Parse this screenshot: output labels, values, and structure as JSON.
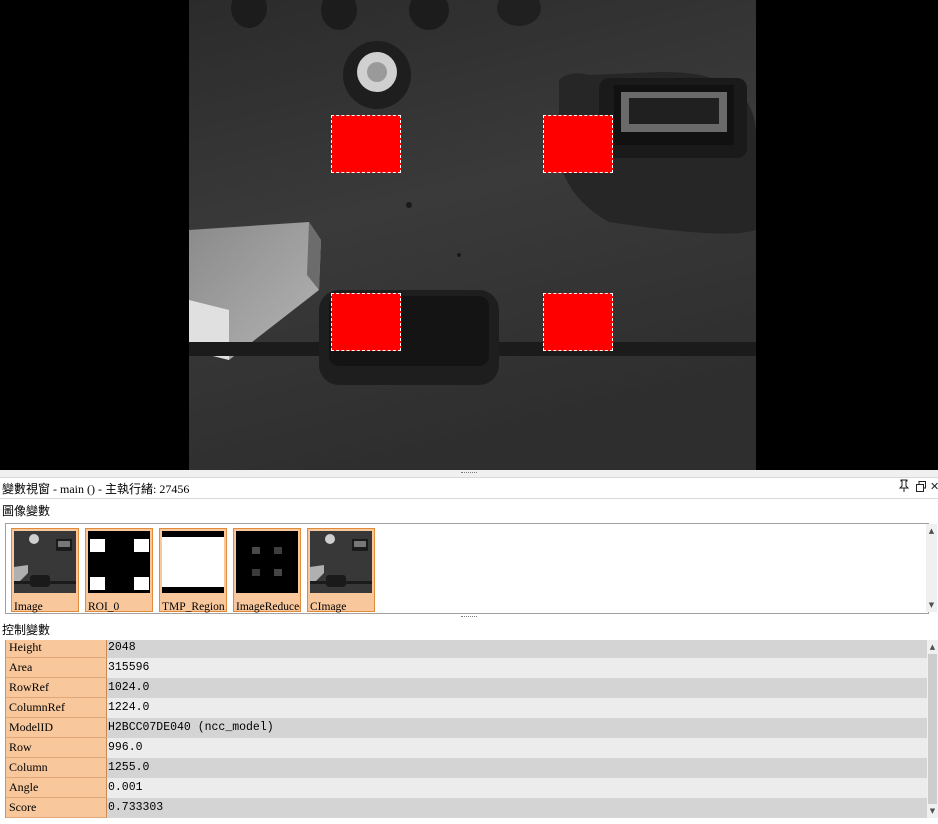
{
  "graphics": {
    "image_description_icon": "grayscale-camera-image-icon"
  },
  "variable_window": {
    "title": "變數視窗 - main () - 主執行緒: 27456",
    "pin_icon": "pin-icon",
    "restore_icon": "restore-window-icon",
    "close_icon": "close-icon"
  },
  "iconic_section": {
    "label": "圖像變數",
    "items": [
      {
        "label": "Image",
        "icon": "image-thumbnail-icon"
      },
      {
        "label": "ROI_0",
        "icon": "roi-thumbnail-icon"
      },
      {
        "label": "TMP_Region",
        "icon": "region-thumbnail-icon"
      },
      {
        "label": "ImageReduced",
        "icon": "reduced-image-thumbnail-icon"
      },
      {
        "label": "CImage",
        "icon": "cimage-thumbnail-icon"
      }
    ]
  },
  "control_section": {
    "label": "控制變數",
    "rows": [
      {
        "name": "Height",
        "value": "2048"
      },
      {
        "name": "Area",
        "value": "315596"
      },
      {
        "name": "RowRef",
        "value": "1024.0"
      },
      {
        "name": "ColumnRef",
        "value": "1224.0"
      },
      {
        "name": "ModelID",
        "value": "H2BCC07DE040 (ncc_model)"
      },
      {
        "name": "Row",
        "value": "996.0"
      },
      {
        "name": "Column",
        "value": "1255.0"
      },
      {
        "name": "Angle",
        "value": "0.001"
      },
      {
        "name": "Score",
        "value": "0.733303"
      }
    ]
  },
  "colors": {
    "roi_fill": "#ff0000",
    "name_cell": "#f8c79c",
    "thumb_border": "#e08b3c"
  }
}
